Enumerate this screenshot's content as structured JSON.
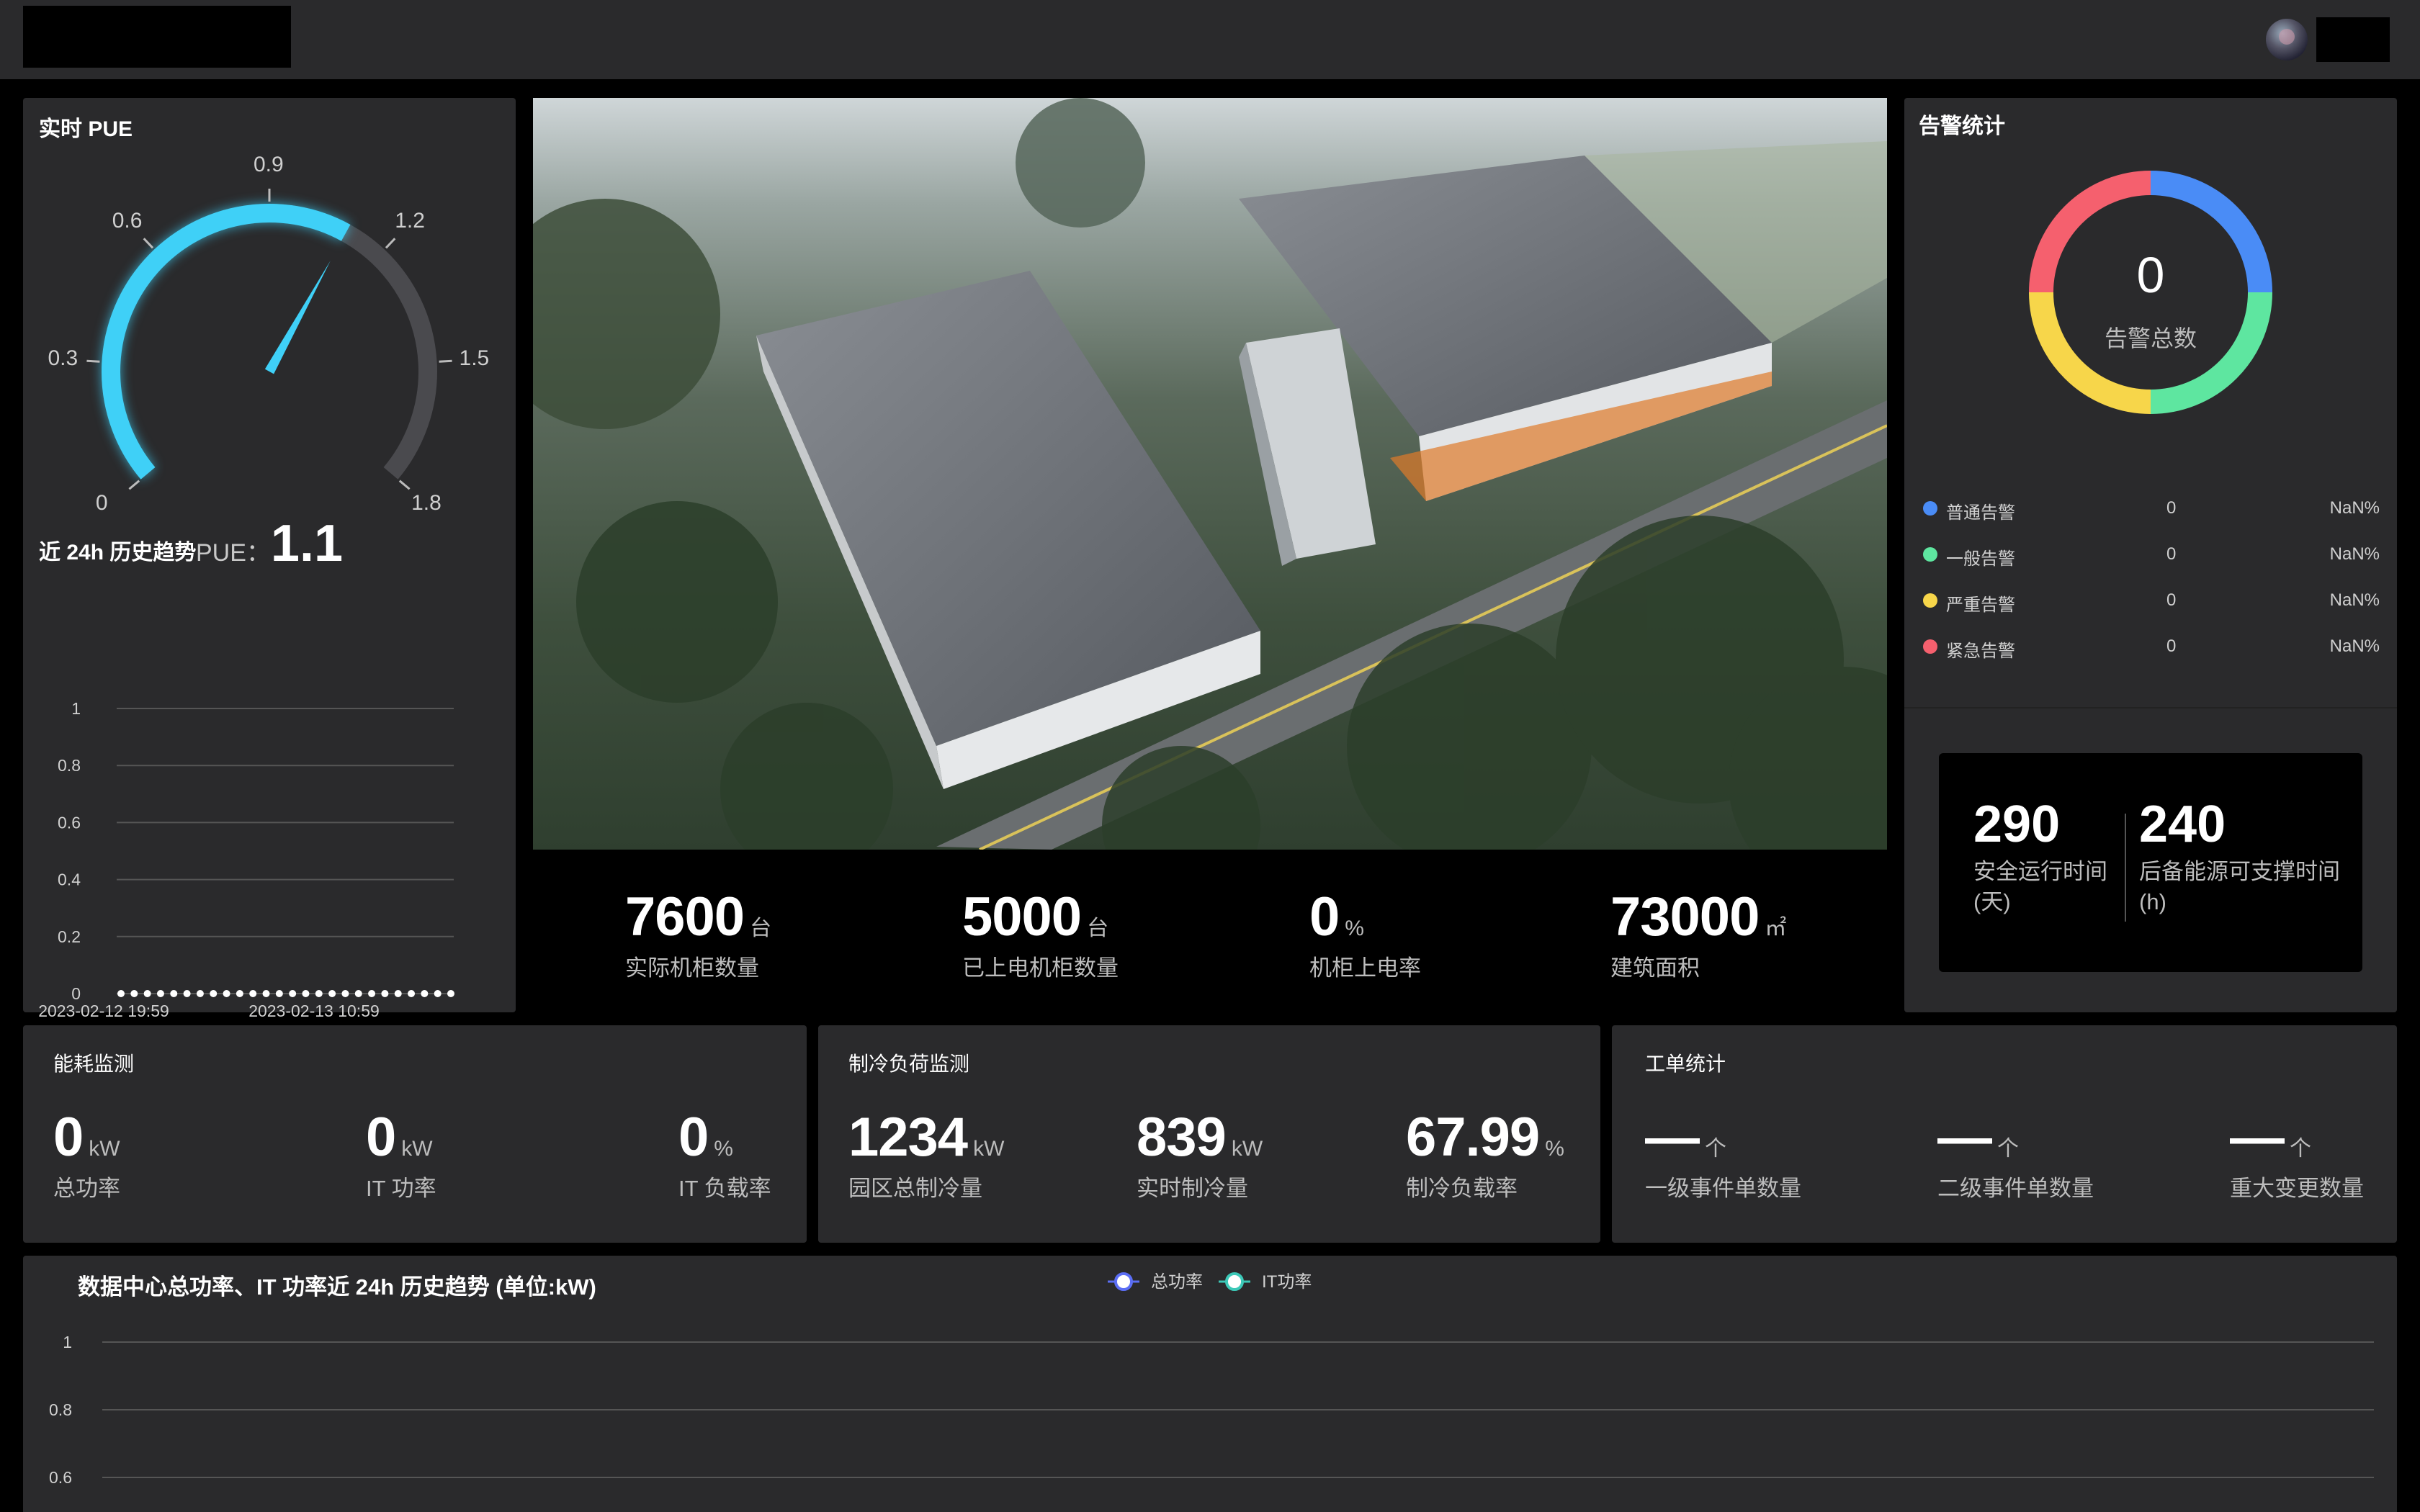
{
  "pue": {
    "title": "实时 PUE",
    "ticks": [
      "0",
      "0.3",
      "0.6",
      "0.9",
      "1.2",
      "1.5",
      "1.8"
    ],
    "label": "PUE：",
    "value": "1.1",
    "value_fraction": 0.611
  },
  "history": {
    "title": "近 24h 历史趋势",
    "y_ticks": [
      "1",
      "0.8",
      "0.6",
      "0.4",
      "0.2",
      "0"
    ],
    "x_labels": [
      "2023-02-12 19:59",
      "2023-02-13 10:59"
    ]
  },
  "stats": [
    {
      "value": "7600",
      "unit": "台",
      "label": "实际机柜数量"
    },
    {
      "value": "5000",
      "unit": "台",
      "label": "已上电机柜数量"
    },
    {
      "value": "0",
      "unit": "%",
      "label": "机柜上电率"
    },
    {
      "value": "73000",
      "unit": "㎡",
      "label": "建筑面积"
    }
  ],
  "alarms": {
    "title": "告警统计",
    "total": "0",
    "total_label": "告警总数",
    "items": [
      {
        "name": "普通告警",
        "count": "0",
        "pct": "NaN%",
        "color": "#4a8cf6"
      },
      {
        "name": "一般告警",
        "count": "0",
        "pct": "NaN%",
        "color": "#5ee6a0"
      },
      {
        "name": "严重告警",
        "count": "0",
        "pct": "NaN%",
        "color": "#f7d64a"
      },
      {
        "name": "紧急告警",
        "count": "0",
        "pct": "NaN%",
        "color": "#f5606e"
      }
    ]
  },
  "safety": {
    "days_value": "290",
    "days_label": "安全运行时间(天)",
    "hours_value": "240",
    "hours_label": "后备能源可支撑时间(h)"
  },
  "energy": {
    "title": "能耗监测",
    "metrics": [
      {
        "value": "0",
        "unit": "kW",
        "label": "总功率"
      },
      {
        "value": "0",
        "unit": "kW",
        "label": "IT 功率"
      },
      {
        "value": "0",
        "unit": "%",
        "label": "IT 负载率"
      }
    ]
  },
  "cooling": {
    "title": "制冷负荷监测",
    "metrics": [
      {
        "value": "1234",
        "unit": "kW",
        "label": "园区总制冷量"
      },
      {
        "value": "839",
        "unit": "kW",
        "label": "实时制冷量"
      },
      {
        "value": "67.99",
        "unit": "%",
        "label": "制冷负载率"
      }
    ]
  },
  "tickets": {
    "title": "工单统计",
    "metrics": [
      {
        "value": "—",
        "unit": "个",
        "label": "一级事件单数量"
      },
      {
        "value": "—",
        "unit": "个",
        "label": "二级事件单数量"
      },
      {
        "value": "—",
        "unit": "个",
        "label": "重大变更数量"
      }
    ]
  },
  "power_chart": {
    "title": "数据中心总功率、IT 功率近 24h 历史趋势 (单位:kW)",
    "legend": [
      "总功率",
      "IT功率"
    ],
    "y_ticks": [
      "1",
      "0.8",
      "0.6"
    ]
  },
  "colors": {
    "gauge_active": "#3fd0f7",
    "gauge_track": "#4a4a4e",
    "panel": "#2a2a2c",
    "total_power": "#5b6ef5",
    "it_power": "#3cc9b8"
  }
}
